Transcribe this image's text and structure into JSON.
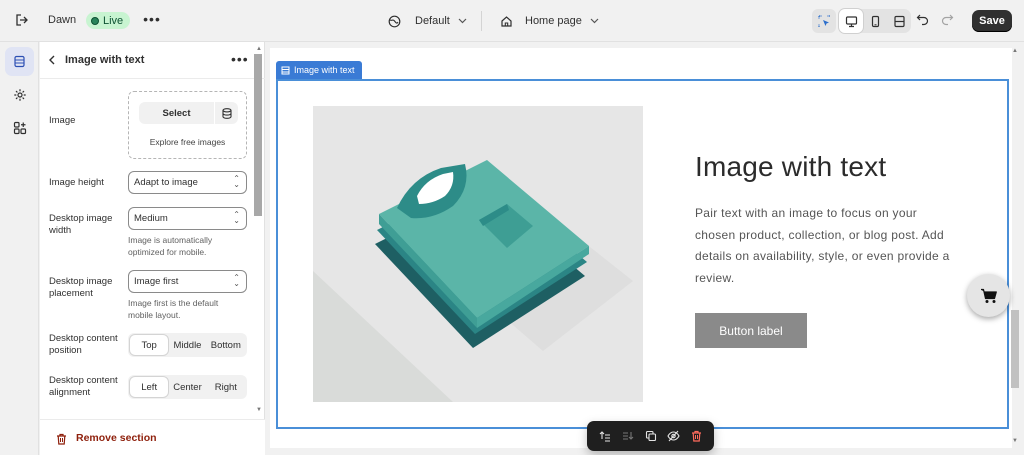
{
  "topbar": {
    "theme_name": "Dawn",
    "live_label": "Live",
    "template_label": "Default",
    "page_label": "Home page",
    "save_label": "Save"
  },
  "panel": {
    "title": "Image with text",
    "fields": {
      "image_label": "Image",
      "select_label": "Select",
      "explore_label": "Explore free images",
      "height_label": "Image height",
      "height_value": "Adapt to image",
      "width_label_1": "Desktop image",
      "width_label_2": "width",
      "width_value": "Medium",
      "width_help_1": "Image is automatically",
      "width_help_2": "optimized for mobile.",
      "placement_label_1": "Desktop image",
      "placement_label_2": "placement",
      "placement_value": "Image first",
      "placement_help_1": "Image first is the default",
      "placement_help_2": "mobile layout.",
      "content_pos_label_1": "Desktop content",
      "content_pos_label_2": "position",
      "content_pos_options": [
        "Top",
        "Middle",
        "Bottom"
      ],
      "content_align_label_1": "Desktop content",
      "content_align_label_2": "alignment",
      "content_align_options": [
        "Left",
        "Center",
        "Right"
      ]
    },
    "remove_label": "Remove section"
  },
  "preview": {
    "section_tag": "Image with text",
    "heading": "Image with text",
    "body": "Pair text with an image to focus on your chosen product, collection, or blog post. Add details on availability, style, or even provide a review.",
    "button_label": "Button label"
  },
  "colors": {
    "accent_blue": "#3a7bd5",
    "live_green": "#c8f4d1",
    "shirt_teal": "#5bb5a8",
    "shirt_dark": "#1e6e6e",
    "danger": "#8e1f0b"
  }
}
